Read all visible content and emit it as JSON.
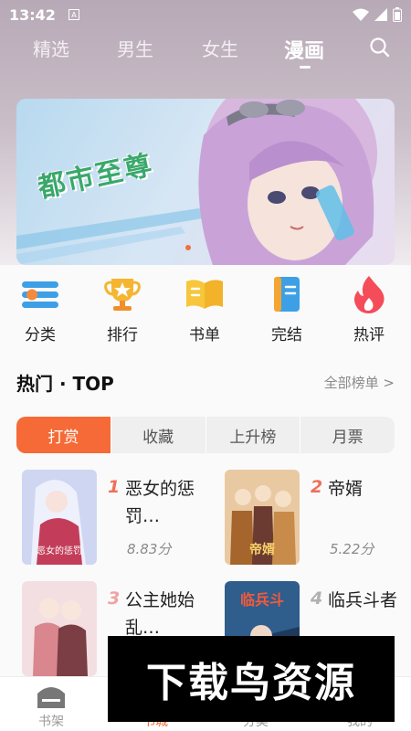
{
  "status_bar": {
    "time": "13:42",
    "notif_letter": "A"
  },
  "nav": {
    "tabs": [
      {
        "label": "精选",
        "active": false
      },
      {
        "label": "男生",
        "active": false
      },
      {
        "label": "女生",
        "active": false
      },
      {
        "label": "漫画",
        "active": true
      }
    ],
    "search_icon": "search-icon"
  },
  "banner": {
    "title": "都市至尊"
  },
  "categories": [
    {
      "label": "分类",
      "icon": "category-icon"
    },
    {
      "label": "排行",
      "icon": "trophy-icon"
    },
    {
      "label": "书单",
      "icon": "book-list-icon"
    },
    {
      "label": "完结",
      "icon": "finished-book-icon"
    },
    {
      "label": "热评",
      "icon": "flame-icon"
    }
  ],
  "hot_section": {
    "title": "热门 · TOP",
    "see_all": "全部榜单 >"
  },
  "rank_tabs": [
    {
      "label": "打赏",
      "active": true
    },
    {
      "label": "收藏",
      "active": false
    },
    {
      "label": "上升榜",
      "active": false
    },
    {
      "label": "月票",
      "active": false
    }
  ],
  "books": [
    {
      "rank": "1",
      "title": "恶女的惩罚…",
      "score": "8.83分"
    },
    {
      "rank": "2",
      "title": "帝婿",
      "score": "5.22分"
    },
    {
      "rank": "3",
      "title": "公主她始乱…",
      "score": ""
    },
    {
      "rank": "4",
      "title": "临兵斗者",
      "score": ""
    }
  ],
  "bottom_nav": [
    {
      "label": "书架",
      "icon": "bookshelf-icon"
    },
    {
      "label": "书城",
      "icon": "bookstore-icon"
    },
    {
      "label": "分类",
      "icon": "category-icon"
    },
    {
      "label": "我的",
      "icon": "profile-icon"
    }
  ],
  "watermark": "下载鸟资源",
  "colors": {
    "accent": "#f56a36",
    "rank_top": "#f0705a",
    "rank_other": "#b0b0b0"
  }
}
